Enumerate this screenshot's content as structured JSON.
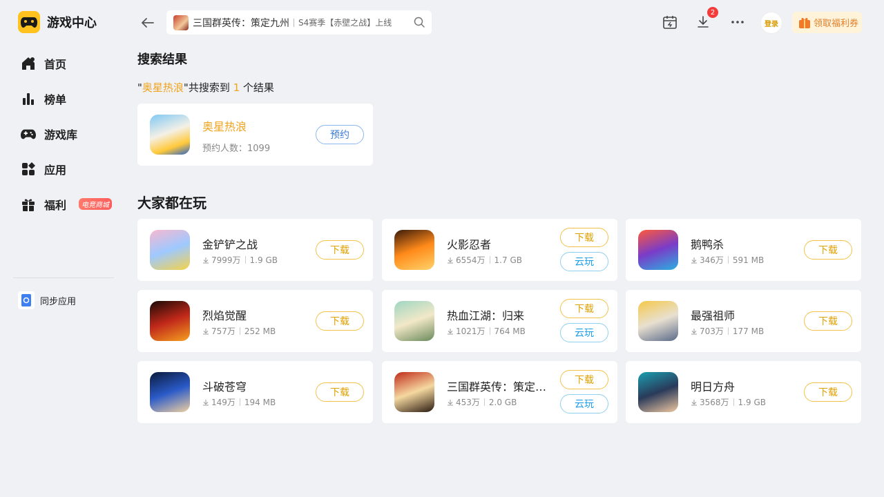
{
  "brand": {
    "title": "游戏中心"
  },
  "nav": [
    {
      "label": "首页",
      "icon": "home-icon"
    },
    {
      "label": "榜单",
      "icon": "ranking-icon"
    },
    {
      "label": "游戏库",
      "icon": "gamepad-icon"
    },
    {
      "label": "应用",
      "icon": "apps-icon"
    },
    {
      "label": "福利",
      "icon": "gift-icon",
      "badge": "电竞商城"
    }
  ],
  "sync": {
    "label": "同步应用"
  },
  "search": {
    "main": "三国群英传：策定九州",
    "sub": "S4赛季【赤壁之战】上线"
  },
  "topbar": {
    "download_badge": "2",
    "login": "登录",
    "coupon": "领取福利券"
  },
  "results": {
    "title": "搜索结果",
    "quote_open": "\"",
    "keyword": "奥星热浪",
    "mid": "\"共搜索到 ",
    "count": "1",
    "tail": " 个结果",
    "item": {
      "name": "奥星热浪",
      "meta": "预约人数：1099",
      "button": "预约"
    }
  },
  "popular": {
    "title": "大家都在玩",
    "download_label": "下载",
    "cloud_label": "云玩",
    "games": [
      {
        "name": "金铲铲之战",
        "downloads": "7999万",
        "size": "1.9 GB",
        "cloud": false
      },
      {
        "name": "火影忍者",
        "downloads": "6554万",
        "size": "1.7 GB",
        "cloud": true
      },
      {
        "name": "鹅鸭杀",
        "downloads": "346万",
        "size": "591 MB",
        "cloud": false
      },
      {
        "name": "烈焰觉醒",
        "downloads": "757万",
        "size": "252 MB",
        "cloud": false
      },
      {
        "name": "热血江湖：归来",
        "downloads": "1021万",
        "size": "764 MB",
        "cloud": true
      },
      {
        "name": "最强祖师",
        "downloads": "703万",
        "size": "177 MB",
        "cloud": false
      },
      {
        "name": "斗破苍穹",
        "downloads": "149万",
        "size": "194 MB",
        "cloud": false
      },
      {
        "name": "三国群英传：策定九州",
        "downloads": "453万",
        "size": "2.0 GB",
        "cloud": true
      },
      {
        "name": "明日方舟",
        "downloads": "3568万",
        "size": "1.9 GB",
        "cloud": false
      }
    ]
  },
  "colors": {
    "accent": "#f0a31c",
    "brand": "#ffc21f",
    "badge_red": "#f33b3b",
    "cloud_blue": "#1e9ee6"
  }
}
